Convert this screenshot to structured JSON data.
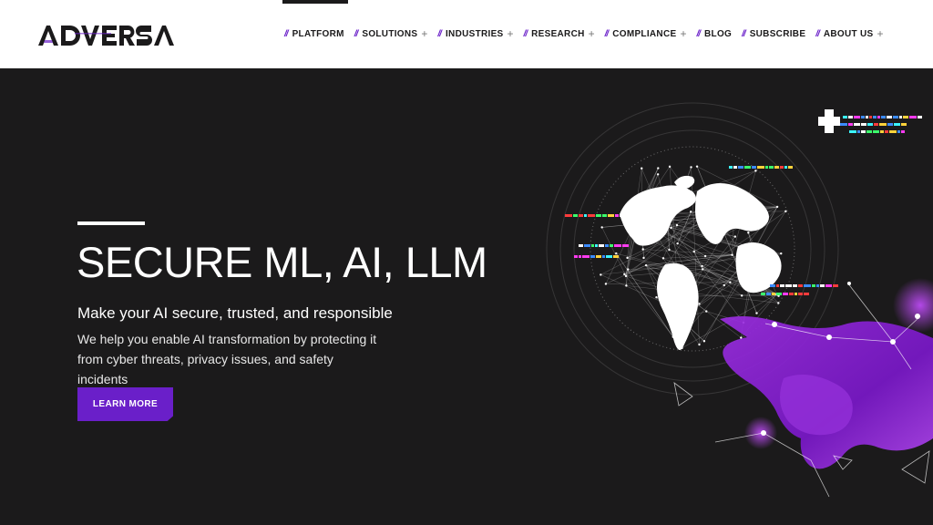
{
  "brand": {
    "name": "ADVERSA",
    "logo_text": "ADVERSA"
  },
  "nav": {
    "separator": "//",
    "items": [
      {
        "label": "PLATFORM",
        "has_submenu": false
      },
      {
        "label": "SOLUTIONS",
        "has_submenu": true
      },
      {
        "label": "INDUSTRIES",
        "has_submenu": true
      },
      {
        "label": "RESEARCH",
        "has_submenu": true
      },
      {
        "label": "COMPLIANCE",
        "has_submenu": true
      },
      {
        "label": "BLOG",
        "has_submenu": false
      },
      {
        "label": "SUBSCRIBE",
        "has_submenu": false
      },
      {
        "label": "ABOUT US",
        "has_submenu": true
      }
    ],
    "submenu_glyph": "+"
  },
  "hero": {
    "title": "SECURE ML, AI, LLM",
    "subtitle": "Make your AI secure, trusted, and responsible",
    "description": "We help you enable AI transformation by protecting it from cyber threats, privacy issues, and safety incidents",
    "cta_label": "LEARN MORE"
  },
  "colors": {
    "accent": "#6a1fc9",
    "hero_background": "#1b1a1b",
    "header_background": "#ffffff"
  },
  "icons": [
    "plus-icon",
    "globe-network-illustration",
    "robotic-hand-illustration"
  ]
}
